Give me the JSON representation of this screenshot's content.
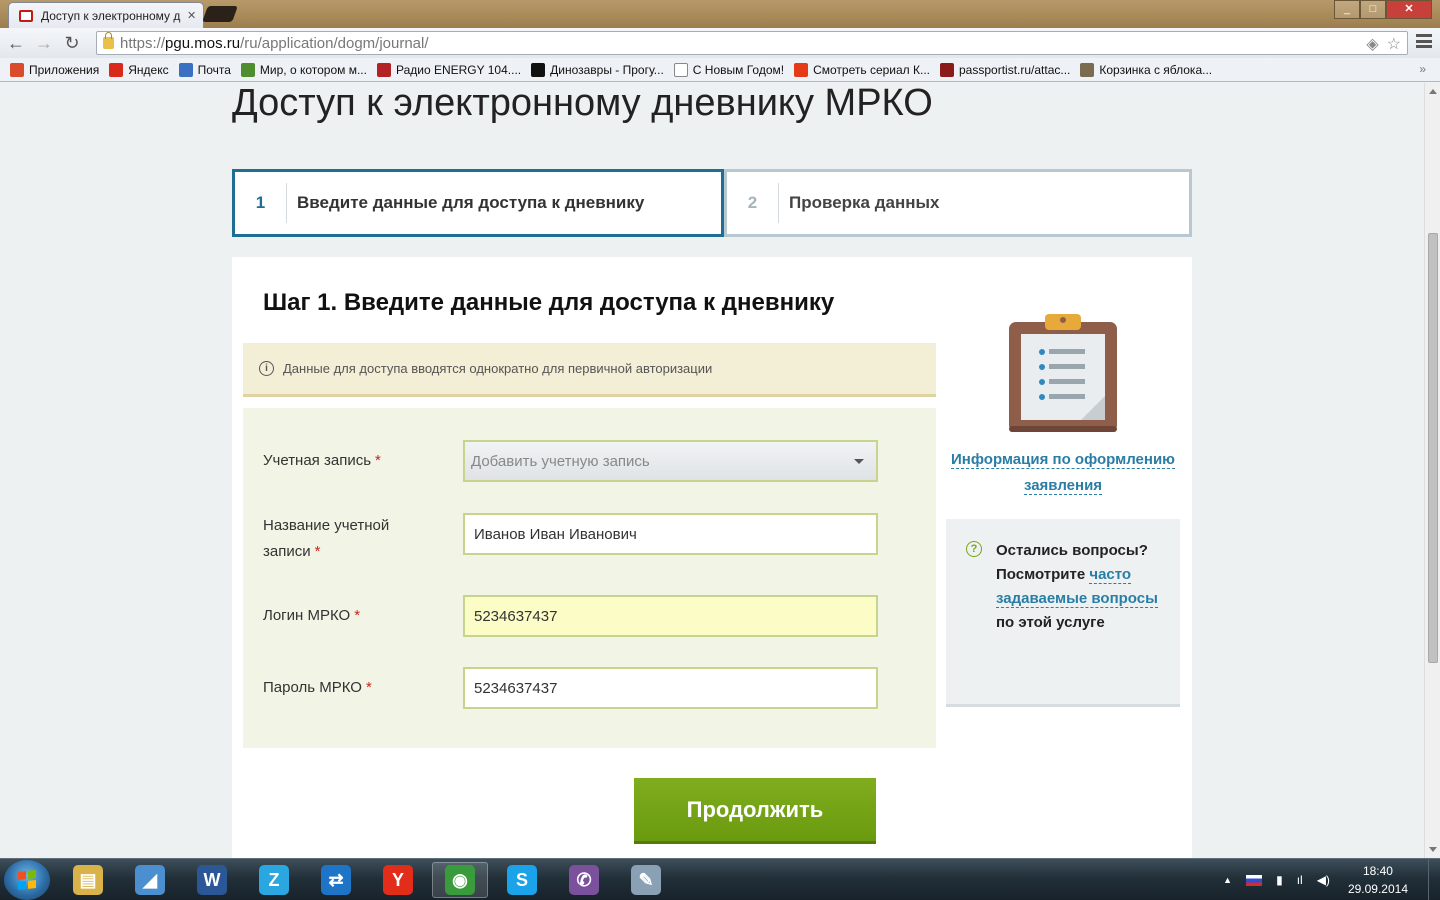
{
  "browser": {
    "tab_title": "Доступ к электронному д",
    "tab_close": "✕",
    "url_proto": "https://",
    "url_host": "pgu.mos.ru",
    "url_path": "/ru/application/dogm/journal/",
    "back_glyph": "←",
    "forward_glyph": "→",
    "reload_glyph": "↻",
    "star_glyph": "☆",
    "shield_glyph": "◈",
    "bookmarks_more": "»",
    "window_controls": {
      "minimize": "_",
      "maximize": "□",
      "close": "✕"
    },
    "bookmarks": [
      {
        "label": "Приложения",
        "icon": "apps-grid-icon",
        "color": "#d94b2b"
      },
      {
        "label": "Яндекс",
        "icon": "yandex-icon",
        "color": "#d9291b"
      },
      {
        "label": "Почта",
        "icon": "mail-icon",
        "color": "#3b6fc2"
      },
      {
        "label": "Мир, о котором м...",
        "icon": "world-icon",
        "color": "#4e8e2f"
      },
      {
        "label": "Радио ENERGY 104....",
        "icon": "radio-icon",
        "color": "#b22222"
      },
      {
        "label": "Динозавры - Прогу...",
        "icon": "bbc-icon",
        "color": "#111111"
      },
      {
        "label": "С Новым Годом!",
        "icon": "page-icon",
        "color": "#ffffff"
      },
      {
        "label": "Смотреть сериал К...",
        "icon": "ctc-icon",
        "color": "#e53a17"
      },
      {
        "label": "passportist.ru/attac...",
        "icon": "passportist-icon",
        "color": "#8b1a1a"
      },
      {
        "label": "Корзинка с яблока...",
        "icon": "basket-icon",
        "color": "#7a6a50"
      }
    ]
  },
  "page": {
    "title": "Доступ к электронному дневнику МРКО",
    "steps": [
      {
        "num": "1",
        "label": "Введите данные для доступа к дневнику"
      },
      {
        "num": "2",
        "label": "Проверка данных"
      }
    ],
    "step_heading": "Шаг 1. Введите данные для доступа к дневнику",
    "notice": "Данные для доступа вводятся однократно для первичной авторизации",
    "info_symbol": "i",
    "required_mark": "*",
    "form": {
      "account_label": "Учетная запись",
      "account_value": "Добавить учетную запись",
      "account_name_label_1": "Название учетной",
      "account_name_label_2": "записи",
      "account_name_value": "Иванов Иван Иванович",
      "login_label": "Логин МРКО",
      "login_value": "5234637437",
      "password_label": "Пароль МРКО",
      "password_value": "5234637437"
    },
    "continue_button": "Продолжить",
    "side": {
      "info_link": "Информация по оформлению заявления",
      "faq_symbol": "?",
      "faq_text_1": "Остались вопросы? Посмотрите ",
      "faq_link": "часто задаваемые вопросы",
      "faq_text_2": " по этой услуге"
    }
  },
  "taskbar": {
    "items": [
      {
        "icon": "explorer-icon",
        "glyph": "▤",
        "color": "#d9b24a"
      },
      {
        "icon": "scanner-icon",
        "glyph": "◢",
        "color": "#4c8fd1"
      },
      {
        "icon": "word-icon",
        "glyph": "W",
        "color": "#2b5797"
      },
      {
        "icon": "zoner-icon",
        "glyph": "Z",
        "color": "#2aa6e0"
      },
      {
        "icon": "teamviewer-icon",
        "glyph": "⇄",
        "color": "#1e74c7"
      },
      {
        "icon": "yandex-browser-icon",
        "glyph": "Y",
        "color": "#e22d1b"
      },
      {
        "icon": "chrome-icon",
        "glyph": "◉",
        "color": "#3a9b3d"
      },
      {
        "icon": "skype-icon",
        "glyph": "S",
        "color": "#1aa3e8"
      },
      {
        "icon": "viber-icon",
        "glyph": "✆",
        "color": "#7b519d"
      },
      {
        "icon": "paint-icon",
        "glyph": "✎",
        "color": "#8aa0b5"
      }
    ],
    "active_index": 6,
    "tray_up": "▲",
    "tray_flag": "RU",
    "tray_network": "▮",
    "tray_signal": "ıl",
    "tray_volume": "◀)",
    "time": "18:40",
    "date": "29.09.2014"
  }
}
